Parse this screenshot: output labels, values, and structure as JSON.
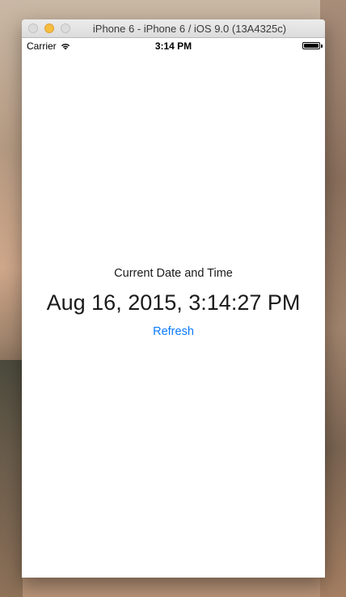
{
  "window": {
    "title": "iPhone 6 - iPhone 6 / iOS 9.0 (13A4325c)"
  },
  "status_bar": {
    "carrier": "Carrier",
    "time": "3:14 PM",
    "battery_level": 1.0,
    "icons": [
      "wifi-icon",
      "battery-icon"
    ]
  },
  "app": {
    "heading": "Current Date and Time",
    "datetime": "Aug 16, 2015, 3:14:27 PM",
    "refresh_label": "Refresh"
  },
  "colors": {
    "link": "#0a7aff",
    "minimize_button": "#f6bd40",
    "text": "#1a1a1a"
  }
}
